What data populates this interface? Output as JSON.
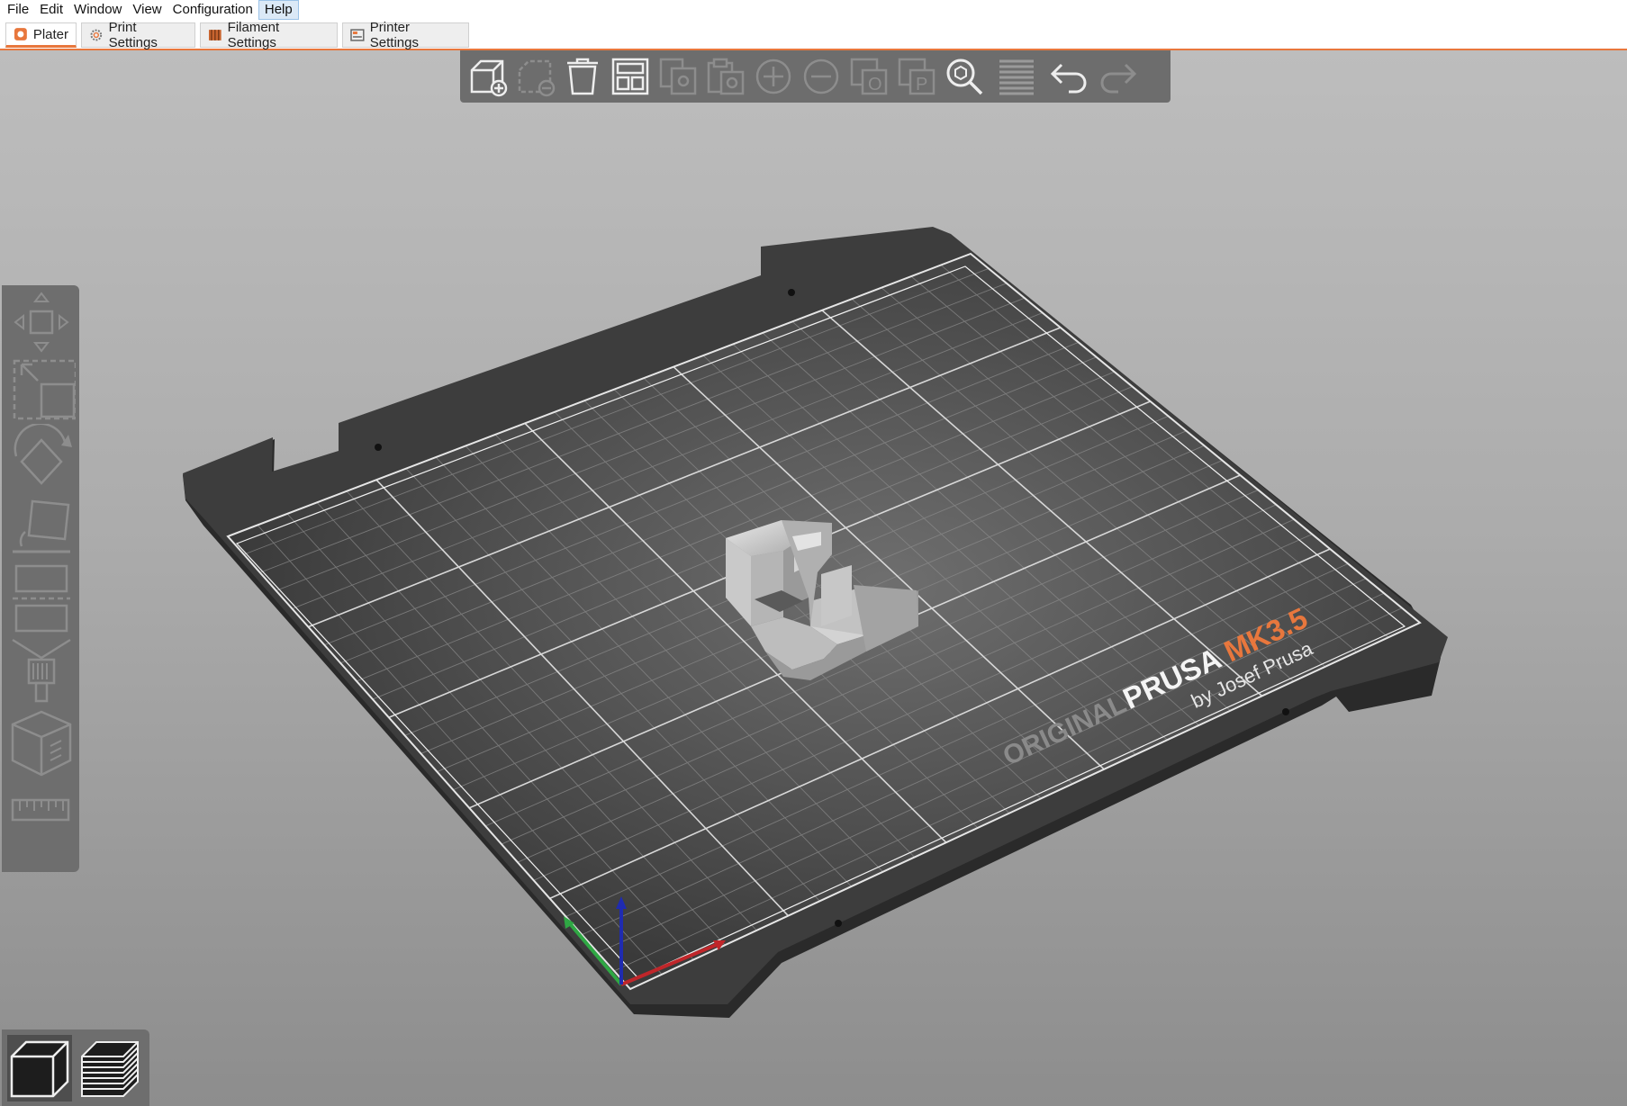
{
  "menu": [
    "File",
    "Edit",
    "Window",
    "View",
    "Configuration",
    "Help"
  ],
  "tabs": [
    {
      "label": "Plater",
      "icon": "plater-icon"
    },
    {
      "label": "Print Settings",
      "icon": "gear-icon"
    },
    {
      "label": "Filament Settings",
      "icon": "filament-spool-icon"
    },
    {
      "label": "Printer Settings",
      "icon": "printer-icon"
    }
  ],
  "toolbar_icons": [
    "add-icon",
    "delete-icon",
    "delete-all-icon",
    "arrange-icon",
    "copy-icon",
    "paste-icon",
    "add-instance-icon",
    "remove-instance-icon",
    "split-to-objects-icon",
    "split-to-parts-icon",
    "search-icon",
    "layer-editing-icon",
    "undo-icon",
    "redo-icon"
  ],
  "gizmo_icons": [
    "move-icon",
    "scale-icon",
    "rotate-icon",
    "place-on-face-icon",
    "cut-icon",
    "paint-supports-icon",
    "simplify-icon",
    "measure-icon"
  ],
  "bed": {
    "logo_original": "ORIGINAL",
    "logo_prusa": "PRUSA",
    "logo_model": "MK3.5",
    "logo_byline": "by Josef Prusa",
    "accent_color": "#e8773d"
  },
  "axes_colors": {
    "x": "#c0262a",
    "y": "#2fa844",
    "z": "#1f2bb0"
  },
  "view_modes": [
    "3d-view-icon",
    "preview-layers-icon"
  ]
}
